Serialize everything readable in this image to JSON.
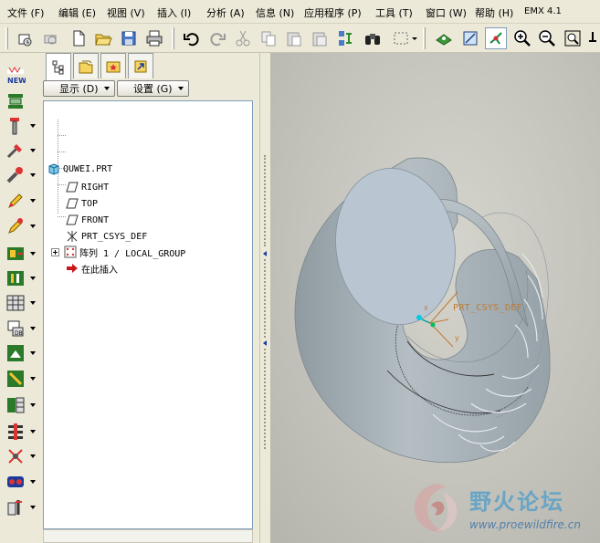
{
  "menu": [
    {
      "label": "文件 (F)"
    },
    {
      "label": "编辑 (E)"
    },
    {
      "label": "视图 (V)"
    },
    {
      "label": "插入 (I)"
    },
    {
      "label": "分析 (A)"
    },
    {
      "label": "信息 (N)"
    },
    {
      "label": "应用程序 (P)"
    },
    {
      "label": "工具 (T)"
    },
    {
      "label": "窗口 (W)"
    },
    {
      "label": "帮助 (H)"
    },
    {
      "label": "EMX 4.1"
    }
  ],
  "toolbar_icons": [
    "open-session-icon",
    "print-preview-icon",
    "new-file-icon",
    "open-folder-icon",
    "save-icon",
    "print-icon",
    "undo-icon",
    "redo-icon",
    "cut-icon",
    "copy-icon",
    "paste-icon",
    "paste-special-icon",
    "regenerate-icon",
    "binoculars-find-icon",
    "select-box-icon",
    "orient-view-icon",
    "refit-icon",
    "spin-center-icon",
    "zoom-in-icon",
    "zoom-out-icon",
    "zoom-fit-icon",
    "extra-icon"
  ],
  "left_toolbar_icons": [
    "new-emx-icon",
    "plate-icon",
    "guide-pin-icon",
    "screw-icon",
    "dowel-icon",
    "pencil-sketch-icon",
    "ejector-icon",
    "slider-icon",
    "cooling-icon",
    "component-icon",
    "cavity-insert-icon",
    "side-core-icon",
    "lifter-icon",
    "plate-stack-icon",
    "ejector-pin-icon",
    "connector-icon",
    "assembly-icon",
    "tool-icon"
  ],
  "panel": {
    "tabs": [
      "model-tree-tab",
      "layer-tab",
      "favorites-tab",
      "connection-tab"
    ],
    "show_label": "显示 (D)",
    "settings_label": "设置 (G)"
  },
  "tree": {
    "root": "QUWEI.PRT",
    "items": [
      {
        "label": "RIGHT",
        "icon": "datum-plane-icon"
      },
      {
        "label": "TOP",
        "icon": "datum-plane-icon"
      },
      {
        "label": "FRONT",
        "icon": "datum-plane-icon"
      },
      {
        "label": "PRT_CSYS_DEF",
        "icon": "csys-icon"
      },
      {
        "label": "阵列 1 / LOCAL_GROUP",
        "icon": "pattern-icon"
      },
      {
        "label": "在此插入",
        "icon": "insert-arrow-icon"
      }
    ]
  },
  "viewport": {
    "csys_label": "PRT_CSYS_DEF",
    "axis_labels": {
      "x": "X",
      "y": "y"
    }
  },
  "watermark": {
    "cn": "野火论坛",
    "url": "www.proewildfire.cn"
  },
  "colors": {
    "model": "#a3adb3",
    "model_light": "#c2cacf",
    "cap": "#b6c4d0",
    "background": "#c4c4bc",
    "csys": "#c07a30",
    "accent": "#5aa0c8"
  }
}
